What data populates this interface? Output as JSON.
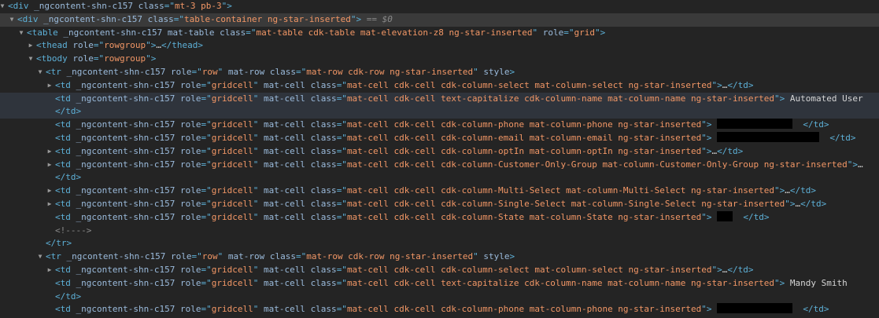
{
  "theme": {
    "background": "#242424",
    "tag": "#5db0d7",
    "attr_name": "#9bbbdc",
    "attr_value": "#f29766",
    "text": "#d5d5d5",
    "comment": "#898989",
    "selected_row": "#3a3a3a",
    "hovered_row": "#2f343c",
    "redaction": "#000000"
  },
  "icons": {
    "expanded": "triangle-down-icon",
    "collapsed": "triangle-right-icon"
  },
  "nodes": [
    {
      "indent": 0,
      "toggle": "expanded",
      "parts": [
        [
          "tag",
          "<div"
        ],
        [
          "txt",
          " "
        ],
        [
          "attr",
          "_ngcontent-shn-c157"
        ],
        [
          "txt",
          " "
        ],
        [
          "attr",
          "class"
        ],
        [
          "tag",
          "=\""
        ],
        [
          "val",
          "mt-3 pb-3"
        ],
        [
          "tag",
          "\">"
        ]
      ]
    },
    {
      "indent": 1,
      "toggle": "expanded",
      "state": "selected",
      "parts": [
        [
          "tag",
          "<div"
        ],
        [
          "txt",
          " "
        ],
        [
          "attr",
          "_ngcontent-shn-c157"
        ],
        [
          "txt",
          " "
        ],
        [
          "attr",
          "class"
        ],
        [
          "tag",
          "=\""
        ],
        [
          "val",
          "table-container ng-star-inserted"
        ],
        [
          "tag",
          "\">"
        ],
        [
          "dim",
          " == $0"
        ]
      ]
    },
    {
      "indent": 2,
      "toggle": "expanded",
      "parts": [
        [
          "tag",
          "<table"
        ],
        [
          "txt",
          " "
        ],
        [
          "attr",
          "_ngcontent-shn-c157"
        ],
        [
          "txt",
          " "
        ],
        [
          "attr",
          "mat-table"
        ],
        [
          "txt",
          " "
        ],
        [
          "attr",
          "class"
        ],
        [
          "tag",
          "=\""
        ],
        [
          "val",
          "mat-table cdk-table mat-elevation-z8 ng-star-inserted"
        ],
        [
          "tag",
          "\""
        ],
        [
          "txt",
          " "
        ],
        [
          "attr",
          "role"
        ],
        [
          "tag",
          "=\""
        ],
        [
          "val",
          "grid"
        ],
        [
          "tag",
          "\">"
        ]
      ]
    },
    {
      "indent": 3,
      "toggle": "collapsed",
      "parts": [
        [
          "tag",
          "<thead"
        ],
        [
          "txt",
          " "
        ],
        [
          "attr",
          "role"
        ],
        [
          "tag",
          "=\""
        ],
        [
          "val",
          "rowgroup"
        ],
        [
          "tag",
          "\">"
        ],
        [
          "txt",
          "…"
        ],
        [
          "tag",
          "</thead>"
        ]
      ]
    },
    {
      "indent": 3,
      "toggle": "expanded",
      "parts": [
        [
          "tag",
          "<tbody"
        ],
        [
          "txt",
          " "
        ],
        [
          "attr",
          "role"
        ],
        [
          "tag",
          "=\""
        ],
        [
          "val",
          "rowgroup"
        ],
        [
          "tag",
          "\">"
        ]
      ]
    },
    {
      "indent": 4,
      "toggle": "expanded",
      "parts": [
        [
          "tag",
          "<tr"
        ],
        [
          "txt",
          " "
        ],
        [
          "attr",
          "_ngcontent-shn-c157"
        ],
        [
          "txt",
          " "
        ],
        [
          "attr",
          "role"
        ],
        [
          "tag",
          "=\""
        ],
        [
          "val",
          "row"
        ],
        [
          "tag",
          "\""
        ],
        [
          "txt",
          " "
        ],
        [
          "attr",
          "mat-row"
        ],
        [
          "txt",
          " "
        ],
        [
          "attr",
          "class"
        ],
        [
          "tag",
          "=\""
        ],
        [
          "val",
          "mat-row cdk-row ng-star-inserted"
        ],
        [
          "tag",
          "\""
        ],
        [
          "txt",
          " "
        ],
        [
          "attr",
          "style"
        ],
        [
          "tag",
          ">"
        ]
      ]
    },
    {
      "indent": 5,
      "toggle": "collapsed",
      "parts": [
        [
          "tag",
          "<td"
        ],
        [
          "txt",
          " "
        ],
        [
          "attr",
          "_ngcontent-shn-c157"
        ],
        [
          "txt",
          " "
        ],
        [
          "attr",
          "role"
        ],
        [
          "tag",
          "=\""
        ],
        [
          "val",
          "gridcell"
        ],
        [
          "tag",
          "\""
        ],
        [
          "txt",
          " "
        ],
        [
          "attr",
          "mat-cell"
        ],
        [
          "txt",
          " "
        ],
        [
          "attr",
          "class"
        ],
        [
          "tag",
          "=\""
        ],
        [
          "val",
          "mat-cell cdk-cell cdk-column-select mat-column-select ng-star-inserted"
        ],
        [
          "tag",
          "\">"
        ],
        [
          "txt",
          "…"
        ],
        [
          "tag",
          "</td>"
        ]
      ]
    },
    {
      "indent": 5,
      "toggle": "none",
      "state": "hovered",
      "parts": [
        [
          "tag",
          "<td"
        ],
        [
          "txt",
          " "
        ],
        [
          "attr",
          "_ngcontent-shn-c157"
        ],
        [
          "txt",
          " "
        ],
        [
          "attr",
          "role"
        ],
        [
          "tag",
          "=\""
        ],
        [
          "val",
          "gridcell"
        ],
        [
          "tag",
          "\""
        ],
        [
          "txt",
          " "
        ],
        [
          "attr",
          "mat-cell"
        ],
        [
          "txt",
          " "
        ],
        [
          "attr",
          "class"
        ],
        [
          "tag",
          "=\""
        ],
        [
          "val",
          "mat-cell cdk-cell text-capitalize cdk-column-name mat-column-name ng-star-inserted"
        ],
        [
          "tag",
          "\">"
        ],
        [
          "txt",
          " Automated User"
        ]
      ]
    },
    {
      "indent": 5,
      "toggle": "none",
      "state": "hovered",
      "parts": [
        [
          "tag",
          "</td>"
        ]
      ]
    },
    {
      "indent": 5,
      "toggle": "none",
      "parts": [
        [
          "tag",
          "<td"
        ],
        [
          "txt",
          " "
        ],
        [
          "attr",
          "_ngcontent-shn-c157"
        ],
        [
          "txt",
          " "
        ],
        [
          "attr",
          "role"
        ],
        [
          "tag",
          "=\""
        ],
        [
          "val",
          "gridcell"
        ],
        [
          "tag",
          "\""
        ],
        [
          "txt",
          " "
        ],
        [
          "attr",
          "mat-cell"
        ],
        [
          "txt",
          " "
        ],
        [
          "attr",
          "class"
        ],
        [
          "tag",
          "=\""
        ],
        [
          "val",
          "mat-cell cdk-cell cdk-column-phone mat-column-phone ng-star-inserted"
        ],
        [
          "tag",
          "\">"
        ],
        [
          "txt",
          " "
        ],
        [
          "redact",
          "96"
        ],
        [
          "txt",
          "  "
        ],
        [
          "tag",
          "</td>"
        ]
      ]
    },
    {
      "indent": 5,
      "toggle": "none",
      "parts": [
        [
          "tag",
          "<td"
        ],
        [
          "txt",
          " "
        ],
        [
          "attr",
          "_ngcontent-shn-c157"
        ],
        [
          "txt",
          " "
        ],
        [
          "attr",
          "role"
        ],
        [
          "tag",
          "=\""
        ],
        [
          "val",
          "gridcell"
        ],
        [
          "tag",
          "\""
        ],
        [
          "txt",
          " "
        ],
        [
          "attr",
          "mat-cell"
        ],
        [
          "txt",
          " "
        ],
        [
          "attr",
          "class"
        ],
        [
          "tag",
          "=\""
        ],
        [
          "val",
          "mat-cell cdk-cell cdk-column-email mat-column-email ng-star-inserted"
        ],
        [
          "tag",
          "\">"
        ],
        [
          "txt",
          " "
        ],
        [
          "redact",
          "130"
        ],
        [
          "txt",
          "  "
        ],
        [
          "tag",
          "</td>"
        ]
      ]
    },
    {
      "indent": 5,
      "toggle": "collapsed",
      "parts": [
        [
          "tag",
          "<td"
        ],
        [
          "txt",
          " "
        ],
        [
          "attr",
          "_ngcontent-shn-c157"
        ],
        [
          "txt",
          " "
        ],
        [
          "attr",
          "role"
        ],
        [
          "tag",
          "=\""
        ],
        [
          "val",
          "gridcell"
        ],
        [
          "tag",
          "\""
        ],
        [
          "txt",
          " "
        ],
        [
          "attr",
          "mat-cell"
        ],
        [
          "txt",
          " "
        ],
        [
          "attr",
          "class"
        ],
        [
          "tag",
          "=\""
        ],
        [
          "val",
          "mat-cell cdk-cell cdk-column-optIn mat-column-optIn ng-star-inserted"
        ],
        [
          "tag",
          "\">"
        ],
        [
          "txt",
          "…"
        ],
        [
          "tag",
          "</td>"
        ]
      ]
    },
    {
      "indent": 5,
      "toggle": "collapsed",
      "parts": [
        [
          "tag",
          "<td"
        ],
        [
          "txt",
          " "
        ],
        [
          "attr",
          "_ngcontent-shn-c157"
        ],
        [
          "txt",
          " "
        ],
        [
          "attr",
          "role"
        ],
        [
          "tag",
          "=\""
        ],
        [
          "val",
          "gridcell"
        ],
        [
          "tag",
          "\""
        ],
        [
          "txt",
          " "
        ],
        [
          "attr",
          "mat-cell"
        ],
        [
          "txt",
          " "
        ],
        [
          "attr",
          "class"
        ],
        [
          "tag",
          "=\""
        ],
        [
          "val",
          "mat-cell cdk-cell cdk-column-Customer-Only-Group mat-column-Customer-Only-Group ng-star-inserted"
        ],
        [
          "tag",
          "\">"
        ],
        [
          "txt",
          "…"
        ]
      ]
    },
    {
      "indent": 5,
      "toggle": "none",
      "parts": [
        [
          "tag",
          "</td>"
        ]
      ]
    },
    {
      "indent": 5,
      "toggle": "collapsed",
      "parts": [
        [
          "tag",
          "<td"
        ],
        [
          "txt",
          " "
        ],
        [
          "attr",
          "_ngcontent-shn-c157"
        ],
        [
          "txt",
          " "
        ],
        [
          "attr",
          "role"
        ],
        [
          "tag",
          "=\""
        ],
        [
          "val",
          "gridcell"
        ],
        [
          "tag",
          "\""
        ],
        [
          "txt",
          " "
        ],
        [
          "attr",
          "mat-cell"
        ],
        [
          "txt",
          " "
        ],
        [
          "attr",
          "class"
        ],
        [
          "tag",
          "=\""
        ],
        [
          "val",
          "mat-cell cdk-cell cdk-column-Multi-Select mat-column-Multi-Select ng-star-inserted"
        ],
        [
          "tag",
          "\">"
        ],
        [
          "txt",
          "…"
        ],
        [
          "tag",
          "</td>"
        ]
      ]
    },
    {
      "indent": 5,
      "toggle": "collapsed",
      "parts": [
        [
          "tag",
          "<td"
        ],
        [
          "txt",
          " "
        ],
        [
          "attr",
          "_ngcontent-shn-c157"
        ],
        [
          "txt",
          " "
        ],
        [
          "attr",
          "role"
        ],
        [
          "tag",
          "=\""
        ],
        [
          "val",
          "gridcell"
        ],
        [
          "tag",
          "\""
        ],
        [
          "txt",
          " "
        ],
        [
          "attr",
          "mat-cell"
        ],
        [
          "txt",
          " "
        ],
        [
          "attr",
          "class"
        ],
        [
          "tag",
          "=\""
        ],
        [
          "val",
          "mat-cell cdk-cell cdk-column-Single-Select mat-column-Single-Select ng-star-inserted"
        ],
        [
          "tag",
          "\">"
        ],
        [
          "txt",
          "…"
        ],
        [
          "tag",
          "</td>"
        ]
      ]
    },
    {
      "indent": 5,
      "toggle": "none",
      "parts": [
        [
          "tag",
          "<td"
        ],
        [
          "txt",
          " "
        ],
        [
          "attr",
          "_ngcontent-shn-c157"
        ],
        [
          "txt",
          " "
        ],
        [
          "attr",
          "role"
        ],
        [
          "tag",
          "=\""
        ],
        [
          "val",
          "gridcell"
        ],
        [
          "tag",
          "\""
        ],
        [
          "txt",
          " "
        ],
        [
          "attr",
          "mat-cell"
        ],
        [
          "txt",
          " "
        ],
        [
          "attr",
          "class"
        ],
        [
          "tag",
          "=\""
        ],
        [
          "val",
          "mat-cell cdk-cell cdk-column-State mat-column-State ng-star-inserted"
        ],
        [
          "tag",
          "\">"
        ],
        [
          "txt",
          " "
        ],
        [
          "redact",
          "20"
        ],
        [
          "txt",
          "  "
        ],
        [
          "tag",
          "</td>"
        ]
      ]
    },
    {
      "indent": 5,
      "toggle": "none",
      "parts": [
        [
          "cmt",
          "<!---->"
        ]
      ]
    },
    {
      "indent": 4,
      "toggle": "none",
      "parts": [
        [
          "tag",
          "</tr>"
        ]
      ]
    },
    {
      "indent": 4,
      "toggle": "expanded",
      "parts": [
        [
          "tag",
          "<tr"
        ],
        [
          "txt",
          " "
        ],
        [
          "attr",
          "_ngcontent-shn-c157"
        ],
        [
          "txt",
          " "
        ],
        [
          "attr",
          "role"
        ],
        [
          "tag",
          "=\""
        ],
        [
          "val",
          "row"
        ],
        [
          "tag",
          "\""
        ],
        [
          "txt",
          " "
        ],
        [
          "attr",
          "mat-row"
        ],
        [
          "txt",
          " "
        ],
        [
          "attr",
          "class"
        ],
        [
          "tag",
          "=\""
        ],
        [
          "val",
          "mat-row cdk-row ng-star-inserted"
        ],
        [
          "tag",
          "\""
        ],
        [
          "txt",
          " "
        ],
        [
          "attr",
          "style"
        ],
        [
          "tag",
          ">"
        ]
      ]
    },
    {
      "indent": 5,
      "toggle": "collapsed",
      "parts": [
        [
          "tag",
          "<td"
        ],
        [
          "txt",
          " "
        ],
        [
          "attr",
          "_ngcontent-shn-c157"
        ],
        [
          "txt",
          " "
        ],
        [
          "attr",
          "role"
        ],
        [
          "tag",
          "=\""
        ],
        [
          "val",
          "gridcell"
        ],
        [
          "tag",
          "\""
        ],
        [
          "txt",
          " "
        ],
        [
          "attr",
          "mat-cell"
        ],
        [
          "txt",
          " "
        ],
        [
          "attr",
          "class"
        ],
        [
          "tag",
          "=\""
        ],
        [
          "val",
          "mat-cell cdk-cell cdk-column-select mat-column-select ng-star-inserted"
        ],
        [
          "tag",
          "\">"
        ],
        [
          "txt",
          "…"
        ],
        [
          "tag",
          "</td>"
        ]
      ]
    },
    {
      "indent": 5,
      "toggle": "none",
      "parts": [
        [
          "tag",
          "<td"
        ],
        [
          "txt",
          " "
        ],
        [
          "attr",
          "_ngcontent-shn-c157"
        ],
        [
          "txt",
          " "
        ],
        [
          "attr",
          "role"
        ],
        [
          "tag",
          "=\""
        ],
        [
          "val",
          "gridcell"
        ],
        [
          "tag",
          "\""
        ],
        [
          "txt",
          " "
        ],
        [
          "attr",
          "mat-cell"
        ],
        [
          "txt",
          " "
        ],
        [
          "attr",
          "class"
        ],
        [
          "tag",
          "=\""
        ],
        [
          "val",
          "mat-cell cdk-cell text-capitalize cdk-column-name mat-column-name ng-star-inserted"
        ],
        [
          "tag",
          "\">"
        ],
        [
          "txt",
          " Mandy Smith"
        ]
      ]
    },
    {
      "indent": 5,
      "toggle": "none",
      "parts": [
        [
          "tag",
          "</td>"
        ]
      ]
    },
    {
      "indent": 5,
      "toggle": "none",
      "parts": [
        [
          "tag",
          "<td"
        ],
        [
          "txt",
          " "
        ],
        [
          "attr",
          "_ngcontent-shn-c157"
        ],
        [
          "txt",
          " "
        ],
        [
          "attr",
          "role"
        ],
        [
          "tag",
          "=\""
        ],
        [
          "val",
          "gridcell"
        ],
        [
          "tag",
          "\""
        ],
        [
          "txt",
          " "
        ],
        [
          "attr",
          "mat-cell"
        ],
        [
          "txt",
          " "
        ],
        [
          "attr",
          "class"
        ],
        [
          "tag",
          "=\""
        ],
        [
          "val",
          "mat-cell cdk-cell cdk-column-phone mat-column-phone ng-star-inserted"
        ],
        [
          "tag",
          "\">"
        ],
        [
          "txt",
          " "
        ],
        [
          "redact",
          "96"
        ],
        [
          "txt",
          "  "
        ],
        [
          "tag",
          "</td>"
        ]
      ]
    }
  ]
}
